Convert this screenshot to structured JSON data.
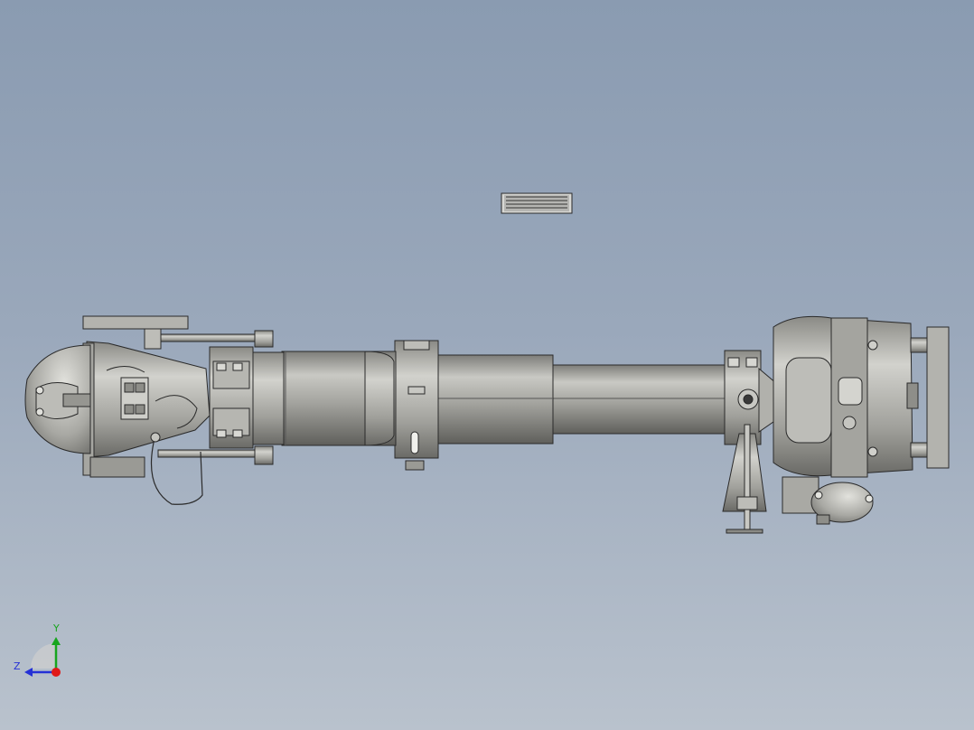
{
  "viewport": {
    "background_top": "#8a9bb1",
    "background_bottom": "#b9c2cd",
    "model_color": "#a6a6a2",
    "edge_color": "#2a2a2a"
  },
  "triad": {
    "y_label": "Y",
    "z_label": "Z",
    "x_color": "#e01818",
    "y_color": "#17a51e",
    "z_color": "#2430d6"
  }
}
